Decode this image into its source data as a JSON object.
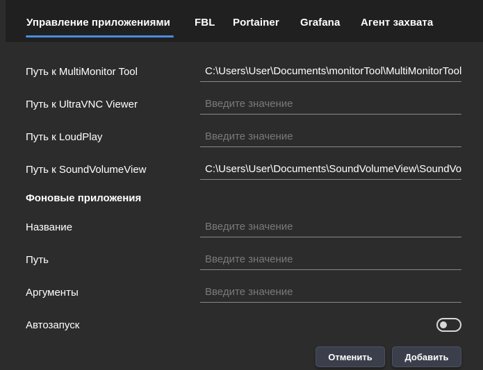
{
  "tabs": [
    {
      "label": "Управление приложениями",
      "active": true
    },
    {
      "label": "FBL",
      "active": false
    },
    {
      "label": "Portainer",
      "active": false
    },
    {
      "label": "Grafana",
      "active": false
    },
    {
      "label": "Агент захвата",
      "active": false
    }
  ],
  "form": {
    "placeholder": "Введите значение",
    "multimonitor": {
      "label": "Путь к MultiMonitor Tool",
      "value": "C:\\Users\\User\\Documents\\monitorTool\\MultiMonitorTool.exe"
    },
    "ultravnc": {
      "label": "Путь к UltraVNC Viewer",
      "value": ""
    },
    "loudplay": {
      "label": "Путь к LoudPlay",
      "value": ""
    },
    "soundvolume": {
      "label": "Путь к SoundVolumeView",
      "value": "C:\\Users\\User\\Documents\\SoundVolumeView\\SoundVolumeView.exe"
    }
  },
  "background_apps": {
    "title": "Фоновые приложения",
    "name": {
      "label": "Название",
      "value": ""
    },
    "path": {
      "label": "Путь",
      "value": ""
    },
    "args": {
      "label": "Аргументы",
      "value": ""
    },
    "autostart": {
      "label": "Автозапуск",
      "enabled": false
    }
  },
  "buttons": {
    "cancel": "Отменить",
    "add": "Добавить"
  },
  "colors": {
    "accent": "#4a8fe0",
    "background": "#2c2c2c",
    "tabbar": "#202020",
    "button": "#3a3f4b"
  }
}
